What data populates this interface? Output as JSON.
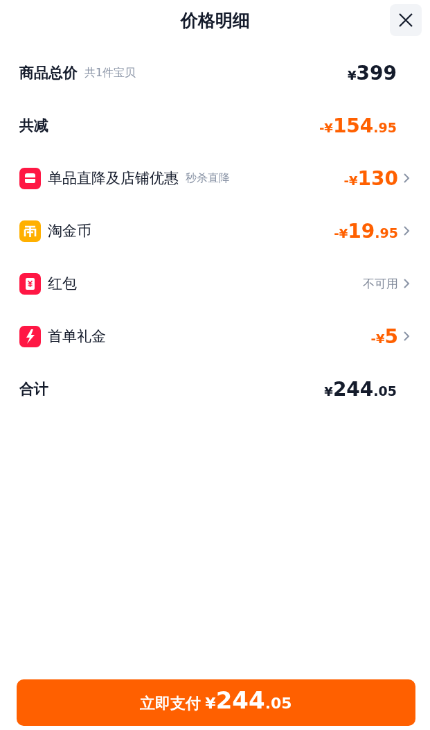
{
  "title": "价格明细",
  "rows": [
    {
      "kind": "summary",
      "label": "商品总价",
      "note": "共1件宝贝",
      "amount": {
        "symbol": "¥",
        "whole": "399"
      }
    },
    {
      "kind": "reduction",
      "label": "共减",
      "amount": {
        "symbol": "-¥",
        "whole": "154",
        "fraction": ".95"
      }
    },
    {
      "kind": "item",
      "label": "单品直降及店铺优惠",
      "note": "秒杀直降",
      "amount": {
        "symbol": "-¥",
        "whole": "130"
      }
    },
    {
      "kind": "item",
      "label": "淘金币",
      "amount": {
        "symbol": "-¥",
        "whole": "19",
        "fraction": ".95"
      }
    },
    {
      "kind": "item",
      "label": "红包",
      "status": "不可用"
    },
    {
      "kind": "item",
      "label": "首单礼金",
      "amount": {
        "symbol": "-¥",
        "whole": "5"
      }
    },
    {
      "kind": "summary",
      "label": "合计",
      "amount": {
        "symbol": "¥",
        "whole": "244",
        "fraction": ".05"
      }
    }
  ],
  "pay_button": {
    "label": "立即支付",
    "amount": {
      "symbol": "¥",
      "whole": "244",
      "fraction": ".05"
    }
  }
}
